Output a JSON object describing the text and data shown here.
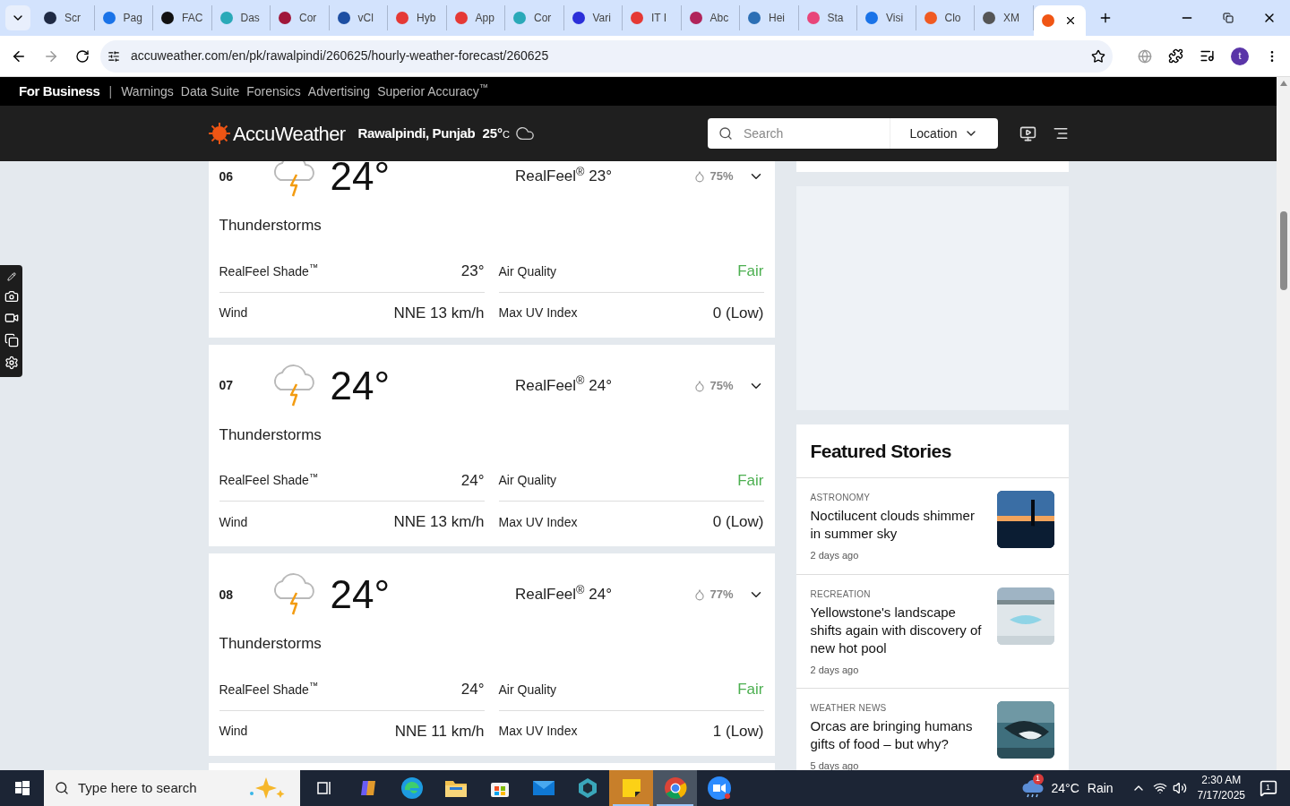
{
  "browser": {
    "tabs": [
      {
        "title": "Scr",
        "color": "#1f2a44",
        "selected": false
      },
      {
        "title": "Pag",
        "color": "#1a73e8",
        "selected": false
      },
      {
        "title": "FAC",
        "color": "#111111",
        "selected": false
      },
      {
        "title": "Das",
        "color": "#2aa9b8",
        "selected": false
      },
      {
        "title": "Cor",
        "color": "#a0173a",
        "selected": false
      },
      {
        "title": "vCl",
        "color": "#1d4fa3",
        "selected": false
      },
      {
        "title": "Hyb",
        "color": "#e53935",
        "selected": false
      },
      {
        "title": "App",
        "color": "#e53935",
        "selected": false
      },
      {
        "title": "Cor",
        "color": "#2aa9b8",
        "selected": false
      },
      {
        "title": "Vari",
        "color": "#2b2fd9",
        "selected": false
      },
      {
        "title": "IT I",
        "color": "#e53935",
        "selected": false
      },
      {
        "title": "Abc",
        "color": "#b0245a",
        "selected": false
      },
      {
        "title": "Hei",
        "color": "#2c6fb5",
        "selected": false
      },
      {
        "title": "Sta",
        "color": "#e8457a",
        "selected": false
      },
      {
        "title": "Visi",
        "color": "#1a73e8",
        "selected": false
      },
      {
        "title": "Clo",
        "color": "#f05a22",
        "selected": false
      },
      {
        "title": "XM",
        "color": "#555555",
        "selected": false
      },
      {
        "color": "#f05514",
        "selected": true
      }
    ],
    "url": "accuweather.com/en/pk/rawalpindi/260625/hourly-weather-forecast/260625",
    "profile": "t"
  },
  "site": {
    "top_nav": {
      "brand": "For Business",
      "separator": "|",
      "links": [
        "Warnings",
        "Data Suite",
        "Forensics",
        "Advertising",
        "Superior Accuracy$^{™}$"
      ]
    },
    "header": {
      "logo": "AccuWeather",
      "location": "Rawalpindi, Punjab",
      "temp": "25°",
      "unit": "C",
      "search_placeholder": "Search",
      "location_button": "Location"
    }
  },
  "forecast": [
    {
      "hour": "06",
      "temp": "24°",
      "condition": "Thunderstorms",
      "realfeel": "RealFeel$^{®}$ 23°",
      "precip": "75%",
      "details": [
        {
          "label": "RealFeel Shade$^{™}$",
          "value": "23°"
        },
        {
          "label": "Air Quality",
          "value": "Fair",
          "color": "#4caf50"
        },
        {
          "label": "Wind",
          "value": "NNE 13 km/h"
        },
        {
          "label": "Max UV Index",
          "value": "0 (Low)"
        }
      ]
    },
    {
      "hour": "07",
      "temp": "24°",
      "condition": "Thunderstorms",
      "realfeel": "RealFeel$^{®}$ 24°",
      "precip": "75%",
      "details": [
        {
          "label": "RealFeel Shade$^{™}$",
          "value": "24°"
        },
        {
          "label": "Air Quality",
          "value": "Fair",
          "color": "#4caf50"
        },
        {
          "label": "Wind",
          "value": "NNE 13 km/h"
        },
        {
          "label": "Max UV Index",
          "value": "0 (Low)"
        }
      ]
    },
    {
      "hour": "08",
      "temp": "24°",
      "condition": "Thunderstorms",
      "realfeel": "RealFeel$^{®}$ 24°",
      "precip": "77%",
      "details": [
        {
          "label": "RealFeel Shade$^{™}$",
          "value": "24°"
        },
        {
          "label": "Air Quality",
          "value": "Fair",
          "color": "#4caf50"
        },
        {
          "label": "Wind",
          "value": "NNE 11 km/h"
        },
        {
          "label": "Max UV Index",
          "value": "1 (Low)"
        }
      ]
    }
  ],
  "featured": {
    "title": "Featured Stories",
    "stories": [
      {
        "category": "ASTRONOMY",
        "headline": "Noctilucent clouds shimmer in summer sky",
        "age": "2 days ago"
      },
      {
        "category": "RECREATION",
        "headline": "Yellowstone's landscape shifts again with discovery of new hot pool",
        "age": "2 days ago"
      },
      {
        "category": "WEATHER NEWS",
        "headline": "Orcas are bringing humans gifts of food – but why?",
        "age": "5 days ago"
      }
    ]
  },
  "taskbar": {
    "search_placeholder": "Type here to search",
    "apps": [
      {
        "kind": "taskview",
        "active": false
      },
      {
        "kind": "copilot",
        "active": false
      },
      {
        "kind": "edge",
        "active": false
      },
      {
        "kind": "explorer",
        "active": false
      },
      {
        "kind": "store",
        "active": false
      },
      {
        "kind": "mail",
        "active": false
      },
      {
        "kind": "gem",
        "active": false
      },
      {
        "kind": "notes",
        "active": true
      },
      {
        "kind": "chrome",
        "active": true
      },
      {
        "kind": "zoom",
        "active": false
      }
    ],
    "weather": {
      "badge": "1",
      "temp": "24°C",
      "condition": "Rain"
    },
    "time": "2:30 AM",
    "date": "7/17/2025",
    "notifications": "1"
  }
}
